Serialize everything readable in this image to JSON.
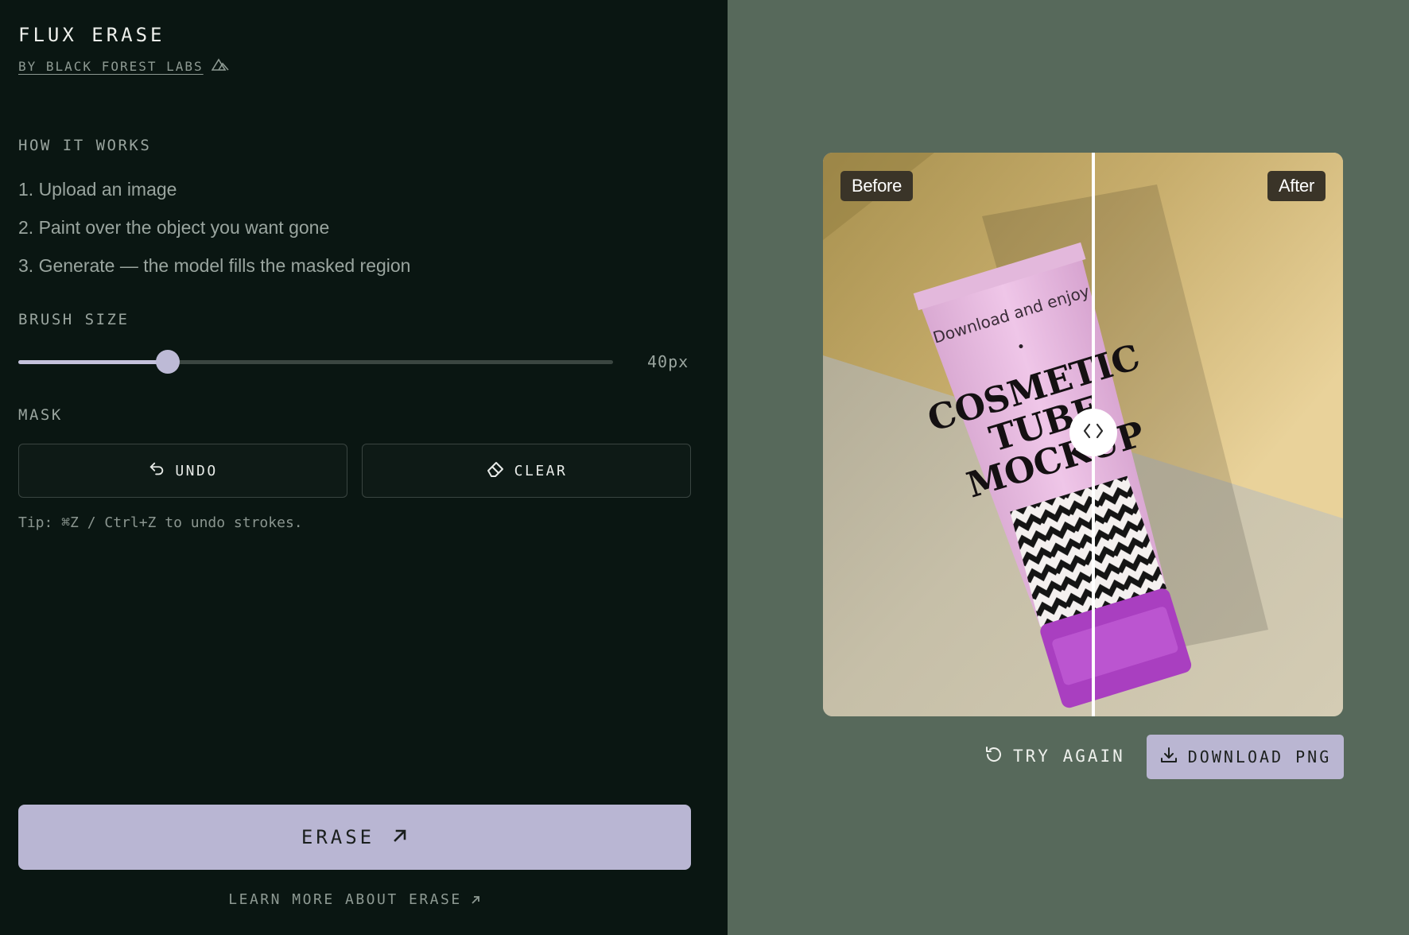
{
  "brand": {
    "title": "FLUX ERASE",
    "subtitle": "BY BLACK FOREST LABS",
    "logo_icon": "bfl-logo-icon"
  },
  "how_it_works": {
    "label": "HOW IT WORKS",
    "steps": [
      "1. Upload an image",
      "2. Paint over the object you want gone",
      "3. Generate — the model fills the masked region"
    ]
  },
  "brush": {
    "label": "BRUSH SIZE",
    "value_text": "40px",
    "level_fraction": 0.252
  },
  "mask": {
    "label": "MASK",
    "undo_label": "UNDO",
    "undo_icon": "undo-icon",
    "clear_label": "CLEAR",
    "clear_icon": "eraser-icon",
    "tip": "Tip: ⌘Z / Ctrl+Z to undo strokes."
  },
  "erase": {
    "label": "ERASE",
    "icon": "arrow-up-right-icon"
  },
  "learn_more": {
    "label": "LEARN MORE ABOUT ERASE",
    "icon": "arrow-up-right-icon"
  },
  "preview": {
    "before_label": "Before",
    "after_label": "After",
    "split_fraction": 0.52,
    "handle_icon": "chevrons-left-right-icon",
    "product": {
      "tagline": "Download and enjoy",
      "line1": "COSMETIC",
      "line2": "TUBE",
      "line3": "MOCKUP"
    }
  },
  "actions": {
    "try_again_label": "TRY AGAIN",
    "try_again_icon": "refresh-icon",
    "download_label": "DOWNLOAD PNG",
    "download_icon": "download-icon"
  },
  "colors": {
    "panel_bg": "#0a1612",
    "preview_bg": "#57695b",
    "accent": "#b9b6d3"
  }
}
